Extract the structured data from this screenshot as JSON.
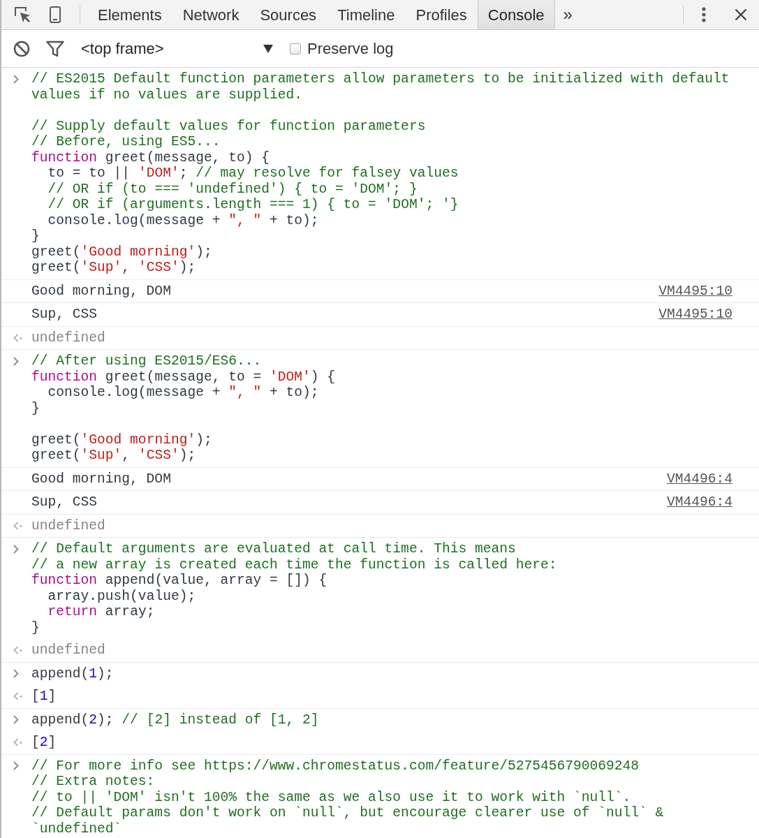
{
  "tabs_bar": {
    "tabs": [
      {
        "label": "Elements",
        "selected": false
      },
      {
        "label": "Network",
        "selected": false
      },
      {
        "label": "Sources",
        "selected": false
      },
      {
        "label": "Timeline",
        "selected": false
      },
      {
        "label": "Profiles",
        "selected": false
      },
      {
        "label": "Console",
        "selected": true
      }
    ],
    "overflow": "»"
  },
  "console_toolbar": {
    "context": "<top frame>",
    "preserve_log": {
      "label": "Preserve log",
      "checked": false
    }
  },
  "messages": [
    {
      "kind": "input",
      "blocks": [
        [
          [
            {
              "text": "// ES2015 Default function parameters allow parameters to be initialized with default values if no values are supplied.",
              "kind": "comment"
            }
          ]
        ],
        [
          [
            {
              "text": "// Supply default values for function parameters",
              "kind": "comment"
            }
          ],
          [
            {
              "text": "// Before, using ES5...",
              "kind": "comment"
            }
          ],
          [
            {
              "text": "function",
              "kind": "keyword"
            },
            {
              "text": " greet(message, to) {",
              "kind": "plain"
            }
          ],
          [
            {
              "text": "  to = to || ",
              "kind": "plain"
            },
            {
              "text": "'DOM'",
              "kind": "string"
            },
            {
              "text": "; ",
              "kind": "plain"
            },
            {
              "text": "// may resolve for falsey values",
              "kind": "comment"
            }
          ],
          [
            {
              "text": "  // OR if (to === 'undefined') { to = 'DOM'; }",
              "kind": "comment"
            }
          ],
          [
            {
              "text": "  // OR if (arguments.length === 1) { to = 'DOM'; '}",
              "kind": "comment"
            }
          ],
          [
            {
              "text": "  console.log(message + ",
              "kind": "plain"
            },
            {
              "text": "\", \"",
              "kind": "string"
            },
            {
              "text": " + to);",
              "kind": "plain"
            }
          ],
          [
            {
              "text": "}",
              "kind": "plain"
            }
          ],
          [
            {
              "text": "greet(",
              "kind": "plain"
            },
            {
              "text": "'Good morning'",
              "kind": "string"
            },
            {
              "text": ");",
              "kind": "plain"
            }
          ],
          [
            {
              "text": "greet(",
              "kind": "plain"
            },
            {
              "text": "'Sup'",
              "kind": "string"
            },
            {
              "text": ", ",
              "kind": "plain"
            },
            {
              "text": "'CSS'",
              "kind": "string"
            },
            {
              "text": ");",
              "kind": "plain"
            }
          ]
        ]
      ]
    },
    {
      "kind": "log",
      "text": "Good morning, DOM",
      "source": "VM4495:10"
    },
    {
      "kind": "log",
      "text": "Sup, CSS",
      "source": "VM4495:10"
    },
    {
      "kind": "result",
      "tokens": [
        {
          "text": "undefined",
          "kind": "undefined"
        }
      ]
    },
    {
      "kind": "input",
      "blocks": [
        [
          [
            {
              "text": "// After using ES2015/ES6...",
              "kind": "comment"
            }
          ],
          [
            {
              "text": "function",
              "kind": "keyword"
            },
            {
              "text": " greet(message, to = ",
              "kind": "plain"
            },
            {
              "text": "'DOM'",
              "kind": "string"
            },
            {
              "text": ") {",
              "kind": "plain"
            }
          ],
          [
            {
              "text": "  console.log(message + ",
              "kind": "plain"
            },
            {
              "text": "\", \"",
              "kind": "string"
            },
            {
              "text": " + to);",
              "kind": "plain"
            }
          ],
          [
            {
              "text": "}",
              "kind": "plain"
            }
          ]
        ],
        [
          [
            {
              "text": "greet(",
              "kind": "plain"
            },
            {
              "text": "'Good morning'",
              "kind": "string"
            },
            {
              "text": ");",
              "kind": "plain"
            }
          ],
          [
            {
              "text": "greet(",
              "kind": "plain"
            },
            {
              "text": "'Sup'",
              "kind": "string"
            },
            {
              "text": ", ",
              "kind": "plain"
            },
            {
              "text": "'CSS'",
              "kind": "string"
            },
            {
              "text": ");",
              "kind": "plain"
            }
          ]
        ]
      ]
    },
    {
      "kind": "log",
      "text": "Good morning, DOM",
      "source": "VM4496:4"
    },
    {
      "kind": "log",
      "text": "Sup, CSS",
      "source": "VM4496:4"
    },
    {
      "kind": "result",
      "tokens": [
        {
          "text": "undefined",
          "kind": "undefined"
        }
      ]
    },
    {
      "kind": "input",
      "blocks": [
        [
          [
            {
              "text": "// Default arguments are evaluated at call time. This means",
              "kind": "comment"
            }
          ],
          [
            {
              "text": "// a new array is created each time the function is called here:",
              "kind": "comment"
            }
          ],
          [
            {
              "text": "function",
              "kind": "keyword"
            },
            {
              "text": " append(value, array = []) {",
              "kind": "plain"
            }
          ],
          [
            {
              "text": "  array.push(value);",
              "kind": "plain"
            }
          ],
          [
            {
              "text": "  return",
              "kind": "keyword"
            },
            {
              "text": " array;",
              "kind": "plain"
            }
          ],
          [
            {
              "text": "}",
              "kind": "plain"
            }
          ]
        ]
      ]
    },
    {
      "kind": "result",
      "tokens": [
        {
          "text": "undefined",
          "kind": "undefined"
        }
      ]
    },
    {
      "kind": "input",
      "blocks": [
        [
          [
            {
              "text": "append(",
              "kind": "plain"
            },
            {
              "text": "1",
              "kind": "number"
            },
            {
              "text": ");",
              "kind": "plain"
            }
          ]
        ]
      ]
    },
    {
      "kind": "result",
      "tokens": [
        {
          "text": "[",
          "kind": "plain"
        },
        {
          "text": "1",
          "kind": "number"
        },
        {
          "text": "]",
          "kind": "plain"
        }
      ]
    },
    {
      "kind": "input",
      "blocks": [
        [
          [
            {
              "text": "append(",
              "kind": "plain"
            },
            {
              "text": "2",
              "kind": "number"
            },
            {
              "text": "); ",
              "kind": "plain"
            },
            {
              "text": "// [2] instead of [1, 2]",
              "kind": "comment"
            }
          ]
        ]
      ]
    },
    {
      "kind": "result",
      "tokens": [
        {
          "text": "[",
          "kind": "plain"
        },
        {
          "text": "2",
          "kind": "number"
        },
        {
          "text": "]",
          "kind": "plain"
        }
      ]
    },
    {
      "kind": "input",
      "blocks": [
        [
          [
            {
              "text": "// For more info see https://www.chromestatus.com/feature/5275456790069248",
              "kind": "comment"
            }
          ],
          [
            {
              "text": "// Extra notes:",
              "kind": "comment"
            }
          ],
          [
            {
              "text": "// to || 'DOM' isn't 100% the same as we also use it to work with `null`.",
              "kind": "comment"
            }
          ],
          [
            {
              "text": "// Default params don't work on `null`, but encourage clearer use of `null` & `undefined`",
              "kind": "comment"
            }
          ]
        ]
      ]
    }
  ]
}
